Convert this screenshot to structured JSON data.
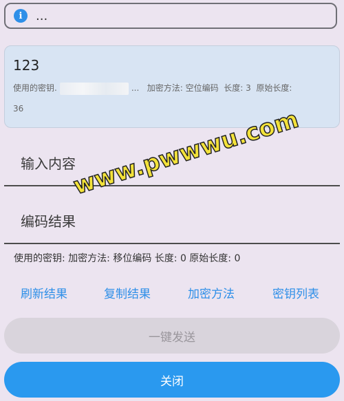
{
  "info": {
    "icon": "info-icon",
    "icon_glyph": "i",
    "text": "..."
  },
  "result": {
    "value": "123",
    "key_label": "使用的密钥.",
    "key_suffix": "...",
    "meta_method": "加密方法: 空位编码",
    "meta_length": "长度: 3",
    "meta_original_label": "原始长度:",
    "meta_original_value": "36"
  },
  "input": {
    "label": "输入内容"
  },
  "output": {
    "label": "编码结果"
  },
  "status": {
    "text": "使用的密钥:   加密方法: 移位编码  长度: 0  原始长度: 0"
  },
  "actions": {
    "refresh": "刷新结果",
    "copy": "复制结果",
    "method": "加密方法",
    "keys": "密钥列表"
  },
  "buttons": {
    "send": "一键发送",
    "close": "关闭"
  },
  "watermark": "www.pwwwu.com",
  "colors": {
    "accent": "#2a99ef",
    "card_bg": "#d8e4f3",
    "page_bg": "#ece4f0"
  }
}
